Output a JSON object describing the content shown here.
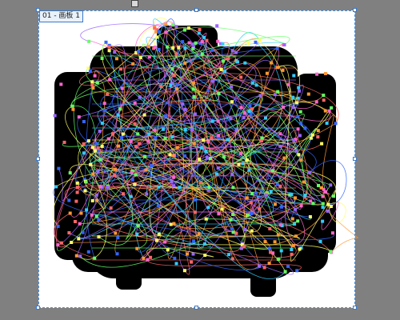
{
  "window": {
    "canvas_background": "#808080",
    "artboard_background": "#ffffff",
    "selection_color": "#3c78c8"
  },
  "artboard": {
    "label": "01 - 画板 1"
  },
  "artwork": {
    "description_icon": "backpack-outline-artwork",
    "fill_color": "#000000",
    "anchor_colors": [
      "#ff66cc",
      "#33ccff",
      "#ffff66",
      "#66ff66",
      "#ff6666",
      "#9966ff",
      "#ff9933",
      "#3366ff"
    ]
  }
}
